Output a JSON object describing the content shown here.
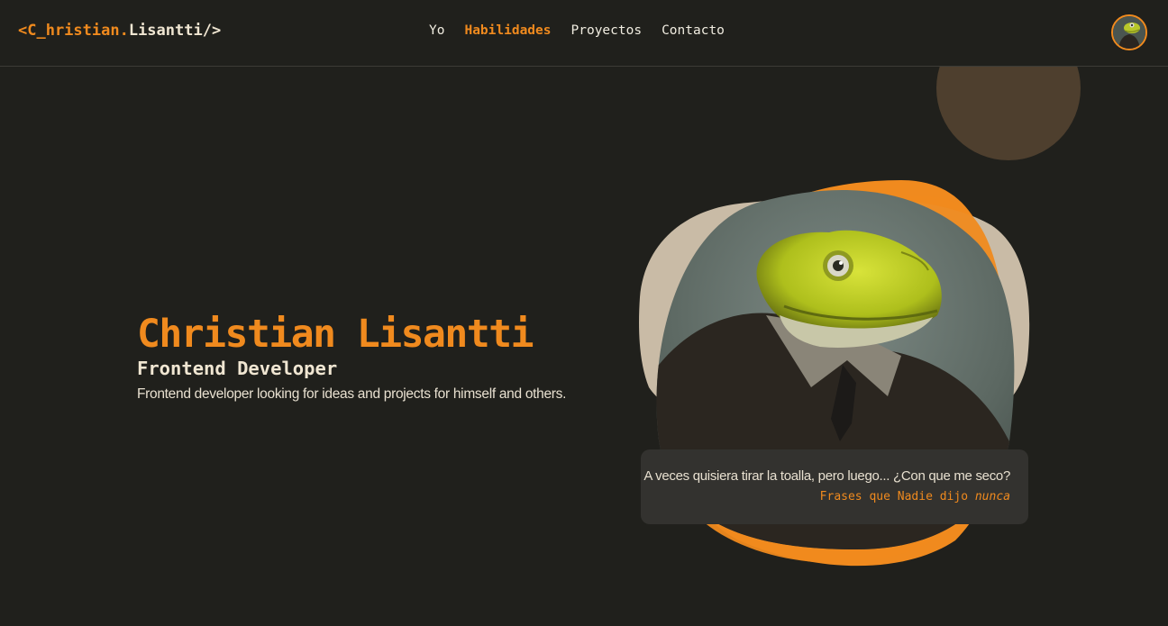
{
  "brand": {
    "logo_prefix": "<C_hristian.",
    "logo_suffix": "Lisantti/>"
  },
  "nav": {
    "items": [
      {
        "label": "Yo",
        "active": false
      },
      {
        "label": "Habilidades",
        "active": true
      },
      {
        "label": "Proyectos",
        "active": false
      },
      {
        "label": "Contacto",
        "active": false
      }
    ]
  },
  "hero": {
    "name": "Christian Lisantti",
    "role": "Frontend Developer",
    "description": "Frontend developer looking for ideas and projects for himself and others."
  },
  "quote": {
    "text": "A veces quisiera tirar la toalla, pero luego... ¿Con que me seco?",
    "source_prefix": "Frases que Nadie dijo ",
    "source_emphasis": "nunca"
  },
  "colors": {
    "background": "#20201c",
    "accent": "#f08a1e",
    "cream": "#f0e6d2",
    "blob_beige": "#c9bba6",
    "deco_brown": "#4e3f2e",
    "card": "#33322f"
  }
}
